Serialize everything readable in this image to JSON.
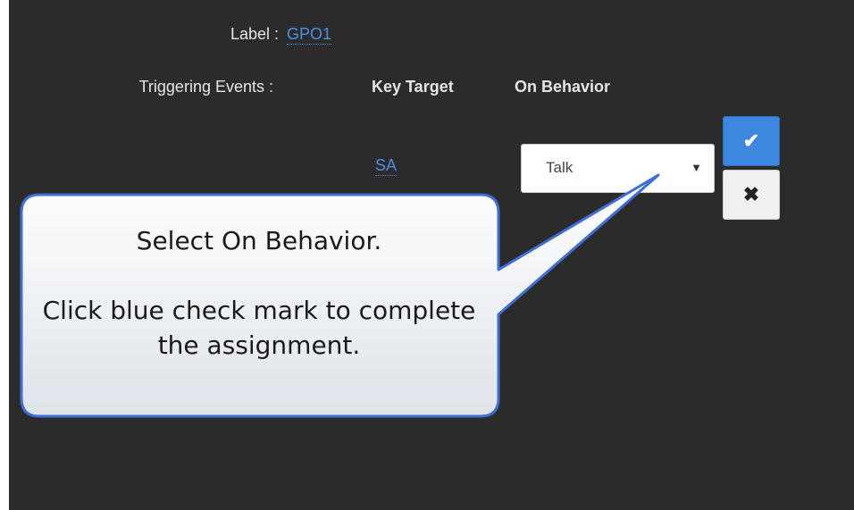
{
  "form": {
    "label_caption": "Label :",
    "label_value": "GPO1",
    "triggering_caption": "Triggering Events :",
    "columns": {
      "key_target": "Key Target",
      "on_behavior": "On Behavior"
    },
    "row": {
      "key_target_value": "SA",
      "on_behavior_selected": "Talk"
    }
  },
  "buttons": {
    "confirm_icon": "checkmark-icon",
    "cancel_icon": "x-icon",
    "confirm_color": "#3d87e0"
  },
  "callout": {
    "line1": "Select On Behavior.",
    "line2": "Click blue check mark to complete the assignment.",
    "border_color": "#3f6fd4"
  }
}
